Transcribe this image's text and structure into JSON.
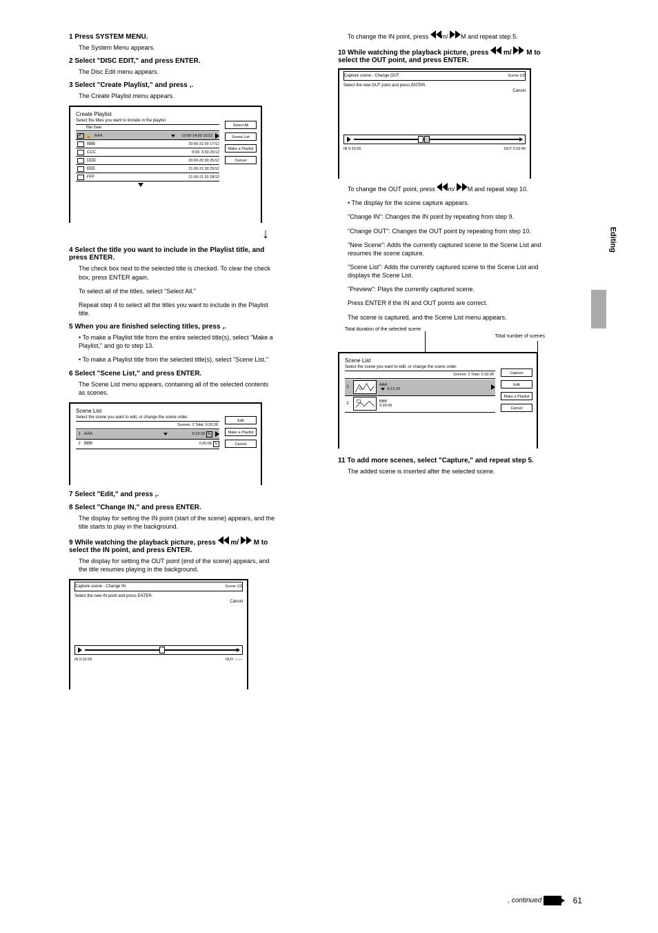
{
  "pageNumber": "61",
  "sideLabel": "Editing",
  "continued": ", continued",
  "headerRight": {
    "p1": "To change the IN point, press ",
    "p2": "/",
    "p3": " and repeat step 5."
  },
  "left": {
    "step1": {
      "num": "1",
      "title": " Press SYSTEM MENU.",
      "body": "The System Menu appears."
    },
    "step2": {
      "num": "2",
      "title": " Select \"DISC EDIT,\" and press ENTER.",
      "body": "The Disc Edit menu appears."
    },
    "step3": {
      "num": "3",
      "title": " Select \"Create Playlist,\" and press ",
      "arrow": "⬇",
      "body": "The Create Playlist menu appears."
    },
    "step4": {
      "num": "4",
      "title": " Select the title you want to include in the Playlist title, and press ENTER.",
      "body1": "The check box next to the selected title is checked. To clear the check box, press ENTER again.",
      "body2": "To select all of the titles, select \"Select All.\"",
      "body3": "Repeat step 4 to select all the titles you want to include in the Playlist title."
    },
    "step5": {
      "num": "5",
      "title1": " When you are finished selecting titles, press ",
      "title2": ".",
      "opt1": "• To make a Playlist title from the entire selected title(s), select \"Make a Playlist,\" and go to step 13.",
      "opt2": "• To make a Playlist title from the selected title(s), select \"Scene List.\""
    },
    "step6": {
      "num": "6",
      "title": " Select \"Scene List,\" and press ENTER.",
      "body": "The Scene List menu appears, containing all of the selected contents as scenes."
    },
    "step7": {
      "num": "7",
      "title1": " Select \"Edit,\" and press ",
      "title2": "."
    },
    "step8": {
      "num": "8",
      "title": " Select \"Change IN,\" and press ENTER.",
      "body": "The display for setting the IN point (start of the scene) appears, and the title starts to play in the background."
    },
    "step9": {
      "num": "9",
      "title1": " While watching the playback picture, press ",
      "title2": "/",
      "title3": " to select the IN point, and press ENTER.",
      "body1": "The display for setting the OUT point (end of the scene) appears, and the title resumes playing in the background."
    }
  },
  "right": {
    "step10": {
      "num": "10",
      "title1": " While watching the playback picture, press ",
      "title2": "/",
      "title3": " to select the OUT point, and press ENTER.",
      "body1": "To change the OUT point, press ",
      "body2": " and repeat step 10.",
      "body3": "Press ENTER if the IN and OUT points are correct.",
      "body4": "The scene is captured, and the Scene List menu appears."
    },
    "captureMenu": {
      "intro": "• The display for the scene capture appears.",
      "change_in": "\"Change IN\": Changes the IN point by repeating from step 9.",
      "change_out": "\"Change OUT\": Changes the OUT point by repeating from step 10.",
      "new_scene": "\"New Scene\": Adds the currently captured scene to the Scene List and resumes the scene capture.",
      "scene_list": "\"Scene List\": Adds the currently captured scene to the Scene List and displays the Scene List.",
      "preview": "\"Preview\": Plays the currently captured scene."
    },
    "callouts": {
      "total": "Total duration of the selected scene",
      "scenes": "Total number of scenes"
    },
    "step11": {
      "num": "11",
      "title": " To add more scenes, select \"Capture,\" and repeat step 5.",
      "body": "The added scene is inserted after the selected scene."
    }
  },
  "screens": {
    "discEdit": {
      "title": "Create Playlist",
      "sub1": "Select the titles you want to include in the playlist.",
      "sub2": "Title    Date",
      "rows": [
        {
          "checked": true,
          "lock": true,
          "name": "AAA",
          "date": "13:00-14:00 15/12",
          "sel": true
        },
        {
          "checked": false,
          "name": "BBB",
          "date": "20:00-21:00 17/12"
        },
        {
          "checked": false,
          "name": "CCC",
          "date": "9:00- 9:30 25/12"
        },
        {
          "checked": false,
          "name": "DDD",
          "date": "20:00-20:30 25/12"
        },
        {
          "checked": false,
          "name": "EEE",
          "date": "21:00-21:30 25/12"
        },
        {
          "checked": false,
          "name": "FFF",
          "date": "21:00-21:30 28/12"
        }
      ],
      "btns": [
        "Select All",
        "Scene List",
        "Make a Playlist",
        "Cancel"
      ]
    },
    "sceneList1": {
      "title": "Scene List",
      "sub": "Select the scene you want to edit, or change the scene order.",
      "header": "Scenes: 2  Total: 0:33:28",
      "rows": [
        {
          "n": "1",
          "name": "AAA",
          "dur": "0:13:19",
          "sel": true
        },
        {
          "n": "2",
          "name": "BBB",
          "dur": "0:20:09"
        }
      ],
      "btns": [
        "Edit",
        "Make a Playlist",
        "Cancel"
      ]
    },
    "captureIn": {
      "title": "Capture scene - Change IN",
      "right": "Scene 1/2",
      "sub": "Select the new IN point and press ENTER.",
      "in": "IN  0:10:26",
      "out": "OUT -:--:--",
      "btn": "Cancel"
    },
    "captureOut": {
      "title": "Capture scene - Change OUT",
      "right": "Scene 1/2",
      "sub": "Select the new OUT point and press ENTER.",
      "in": "IN  0:10:26",
      "out": "OUT 0:23:45",
      "btn": "Cancel"
    },
    "sceneList2": {
      "title": "Scene List",
      "sub": "Select the scene you want to edit, or change the scene order.",
      "header": "Scenes: 2  Total: 0:33:28",
      "rows": [
        {
          "n": "1",
          "name": "AAA",
          "dur": "0:13:19",
          "sel": true
        },
        {
          "n": "2",
          "name": "BBB",
          "dur": "0:20:09"
        }
      ],
      "btns": [
        "Capture",
        "Edit",
        "Make a Playlist",
        "Cancel"
      ]
    }
  }
}
